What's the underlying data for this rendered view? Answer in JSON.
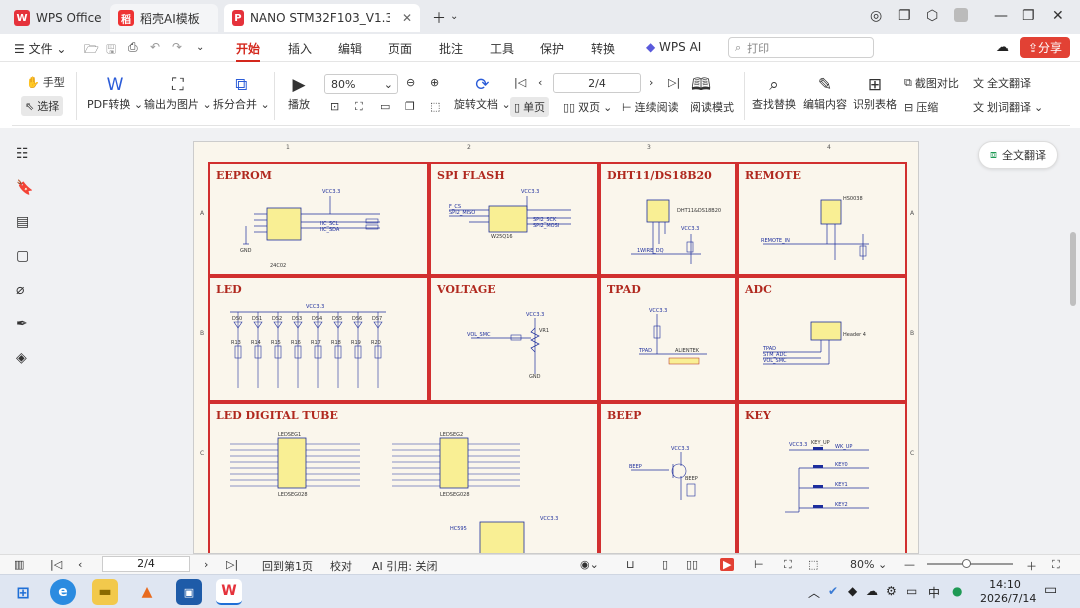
{
  "tabs": [
    {
      "label": "WPS Office"
    },
    {
      "label": "稻壳AI模板"
    },
    {
      "label": "NANO STM32F103_V1.3_SCH.pdf"
    }
  ],
  "menu": {
    "file": "文件",
    "items": [
      "开始",
      "插入",
      "编辑",
      "页面",
      "批注",
      "工具",
      "保护",
      "转换"
    ],
    "wps_ai": "WPS AI",
    "search_placeholder": "打印",
    "share": "分享"
  },
  "ribbon": {
    "hand": "手型",
    "select": "选择",
    "pdf_convert": "PDF转换",
    "export_image": "输出为图片",
    "split_merge": "拆分合并",
    "play": "播放",
    "zoom_value": "80%",
    "page_value": "2/4",
    "rotate": "旋转文档",
    "single": "单页",
    "double": "双页",
    "continuous": "连续阅读",
    "read_mode": "阅读模式",
    "find_replace": "查找替换",
    "edit_content": "编辑内容",
    "recognize_table": "识别表格",
    "screenshot_compare": "截图对比",
    "compress": "压缩",
    "full_translate": "全文翻译",
    "word_translate": "划词翻译"
  },
  "float_translate": "全文翻译",
  "schematic": {
    "col_numbers": [
      "1",
      "2",
      "3",
      "4"
    ],
    "row_letters": [
      "A",
      "B",
      "C"
    ],
    "sections": {
      "eeprom": "EEPROM",
      "spi_flash": "SPI FLASH",
      "dht": "DHT11/DS18B20",
      "remote": "REMOTE",
      "led": "LED",
      "voltage": "VOLTAGE",
      "tpad": "TPAD",
      "adc": "ADC",
      "tube": "LED DIGITAL TUBE",
      "beep": "BEEP",
      "key": "KEY"
    },
    "labels": {
      "vcc33": "VCC3.3",
      "gnd": "GND",
      "chip_24c02": "24C02",
      "chip_w25q16": "W25Q16",
      "dht11": "DHT11&DS18B20",
      "hs0038": "HS0038",
      "remote_in": "REMOTE_IN",
      "onewire": "1WIRE_DQ",
      "vol_smc": "VOL_SMC",
      "tpad": "TPAD",
      "header4": "Header 4",
      "stm_adc": "STM_ADC",
      "beep": "BEEP",
      "key_up": "KEY_UP",
      "key0": "KEY0",
      "key1": "KEY1",
      "key2": "KEY2",
      "wk_up": "WK_UP",
      "ledseg1": "LEDSEG1",
      "ledseg2": "LEDSEG2",
      "ledseg028": "LEDSEG028",
      "hc595": "HC595",
      "spi2_sck": "SPI2_SCK",
      "spi2_mosi": "SPI2_MOSI",
      "spi2_miso": "SPI2_MISO",
      "f_cs": "F_CS",
      "iic_scl": "IIC_SCL",
      "iic_sda": "IIC_SDA",
      "aliented": "ALIENTEK",
      "vr1": "VR1",
      "r10k": "10K"
    },
    "led_names": [
      "DS0",
      "DS1",
      "DS2",
      "DS3",
      "DS4",
      "DS5",
      "DS6",
      "DS7"
    ],
    "led_resistors": [
      "R13",
      "R14",
      "R15",
      "R16",
      "R17",
      "R18",
      "R19",
      "R20"
    ]
  },
  "status": {
    "page": "2/4",
    "back_first": "回到第1页",
    "proofread": "校对",
    "ai_cite": "AI 引用: 关闭",
    "zoom": "80%"
  },
  "taskbar": {
    "time": "14:10",
    "date": "2026/7/14",
    "ime": "中"
  },
  "colors": {
    "accent": "#d4281d",
    "schematic_border": "#d12f2f",
    "chip_fill": "#f9ef94",
    "wire_blue": "#1d2e9c",
    "paper": "#faf6ec"
  }
}
